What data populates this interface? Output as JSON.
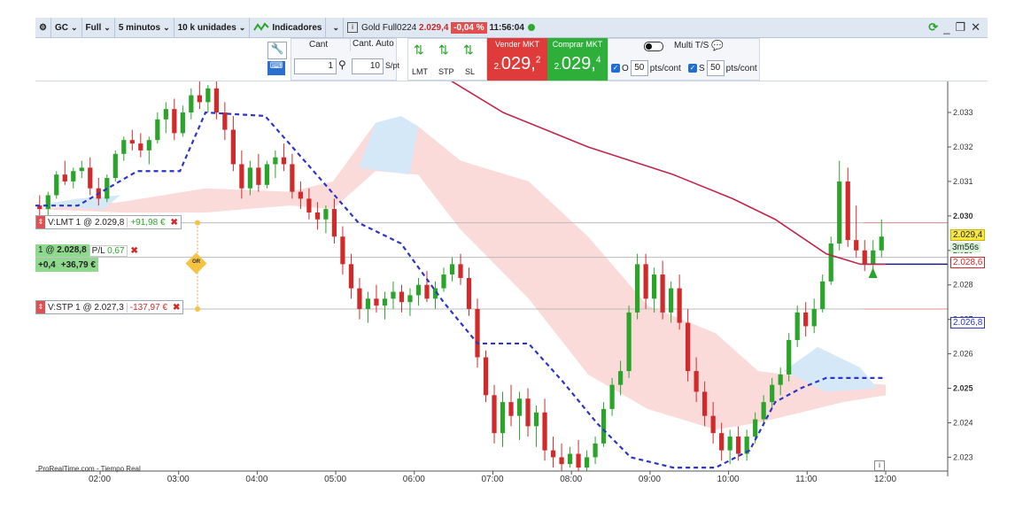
{
  "toolbar": {
    "symbol": "GC",
    "mode": "Full",
    "timeframe": "5 minutos",
    "units": "10 k unidades",
    "indicators": "Indicadores",
    "instrument": "Gold Full0224",
    "last_price": "2.029,4",
    "change_pct": "-0,04 %",
    "clock": "11:56:04"
  },
  "order_panel": {
    "cant_label": "Cant",
    "cant_auto_label": "Cant. Auto",
    "cant_value": "1",
    "spt_value": "10",
    "spt_label": "S/pt",
    "lmt_label": "LMT",
    "stp_label": "STP",
    "sl_label": "SL",
    "sell_label": "Vender MKT",
    "sell_price_prefix": "2.",
    "sell_price_main": "029,",
    "sell_price_sup": "2",
    "buy_label": "Comprar MKT",
    "buy_price_prefix": "2.",
    "buy_price_main": "029,",
    "buy_price_sup": "4",
    "multi_label": "Multi T/S",
    "o_label": "O",
    "o_value": "50",
    "s_label": "S",
    "s_value": "50",
    "pts_label": "pts/cont"
  },
  "orders": {
    "lmt_text": "V:LMT  1  @  2.029,8",
    "lmt_pl": "+91,98 €",
    "pos_text_pre": "1  @ ",
    "pos_text_price": "2.028,8",
    "pos_pl_label": " P/L ",
    "pos_pl_value": "0,67",
    "pos_pts": "+0,4",
    "pos_eur": "+36,79 €",
    "oco_label": "OR",
    "stp_text": "V:STP  1  @  2.027,3",
    "stp_pl": "-137,97 €"
  },
  "price_tags": {
    "last": "2.029,4",
    "timer": "3m56s",
    "entry": "2.028,6",
    "baseline": "2.026,8"
  },
  "source_label": "ProRealTime.com - Tiempo Real",
  "chart_data": {
    "type": "candlestick",
    "x_ticks": [
      "02:00",
      "03:00",
      "04:00",
      "05:00",
      "06:00",
      "07:00",
      "08:00",
      "09:00",
      "10:00",
      "11:00",
      "12:00"
    ],
    "y_ticks": [
      "2.033",
      "2.032",
      "2.031",
      "2.030",
      "2.029",
      "2.028",
      "2.027",
      "2.026",
      "2.025",
      "2.024",
      "2.023"
    ],
    "y_range": [
      2022.6,
      2033.9
    ],
    "colors": {
      "up": "#2aa52a",
      "down": "#d22a2a",
      "ma": "#c0254a",
      "kijun": "#2d35c8",
      "cloud_red": "#fbdada",
      "cloud_blue": "#d4e8f8"
    },
    "candles": [
      [
        2030.3,
        2030.6,
        2029.9,
        2030.2
      ],
      [
        2030.2,
        2030.7,
        2030.0,
        2030.6
      ],
      [
        2030.6,
        2031.3,
        2030.5,
        2031.2
      ],
      [
        2031.2,
        2031.6,
        2030.9,
        2031.0
      ],
      [
        2031.0,
        2031.4,
        2030.8,
        2031.3
      ],
      [
        2031.3,
        2031.6,
        2031.1,
        2031.4
      ],
      [
        2031.4,
        2031.7,
        2030.6,
        2030.8
      ],
      [
        2030.8,
        2031.1,
        2030.3,
        2030.5
      ],
      [
        2030.5,
        2031.2,
        2030.4,
        2031.1
      ],
      [
        2031.1,
        2031.9,
        2031.0,
        2031.8
      ],
      [
        2031.8,
        2032.3,
        2031.6,
        2032.2
      ],
      [
        2032.2,
        2032.5,
        2031.9,
        2032.1
      ],
      [
        2032.1,
        2032.4,
        2031.7,
        2031.9
      ],
      [
        2031.9,
        2032.3,
        2031.5,
        2032.2
      ],
      [
        2032.2,
        2033.0,
        2032.1,
        2032.8
      ],
      [
        2032.8,
        2033.3,
        2032.4,
        2033.1
      ],
      [
        2033.1,
        2033.4,
        2032.2,
        2032.4
      ],
      [
        2032.4,
        2033.2,
        2032.3,
        2033.0
      ],
      [
        2033.0,
        2033.7,
        2032.8,
        2033.5
      ],
      [
        2033.5,
        2033.9,
        2033.1,
        2033.3
      ],
      [
        2033.3,
        2033.8,
        2033.0,
        2033.7
      ],
      [
        2033.7,
        2033.9,
        2032.8,
        2033.0
      ],
      [
        2033.0,
        2033.3,
        2032.2,
        2032.5
      ],
      [
        2032.5,
        2032.9,
        2031.3,
        2031.5
      ],
      [
        2031.5,
        2031.9,
        2030.5,
        2030.8
      ],
      [
        2030.8,
        2031.6,
        2030.6,
        2031.4
      ],
      [
        2031.4,
        2031.8,
        2030.7,
        2030.9
      ],
      [
        2030.9,
        2031.6,
        2030.8,
        2031.5
      ],
      [
        2031.5,
        2031.9,
        2031.1,
        2031.7
      ],
      [
        2031.7,
        2032.1,
        2031.3,
        2031.5
      ],
      [
        2031.5,
        2031.8,
        2030.5,
        2030.7
      ],
      [
        2030.7,
        2031.0,
        2030.2,
        2030.5
      ],
      [
        2030.5,
        2030.8,
        2029.9,
        2030.1
      ],
      [
        2030.1,
        2030.4,
        2029.6,
        2029.9
      ],
      [
        2029.9,
        2030.3,
        2029.5,
        2030.2
      ],
      [
        2030.2,
        2030.5,
        2029.2,
        2029.4
      ],
      [
        2029.4,
        2029.7,
        2028.3,
        2028.6
      ],
      [
        2028.6,
        2028.9,
        2027.6,
        2027.9
      ],
      [
        2027.9,
        2028.2,
        2027.0,
        2027.3
      ],
      [
        2027.3,
        2027.8,
        2026.9,
        2027.6
      ],
      [
        2027.6,
        2028.0,
        2027.2,
        2027.4
      ],
      [
        2027.4,
        2027.8,
        2027.0,
        2027.6
      ],
      [
        2027.6,
        2028.1,
        2027.3,
        2027.8
      ],
      [
        2027.8,
        2028.0,
        2027.2,
        2027.5
      ],
      [
        2027.5,
        2027.9,
        2027.1,
        2027.7
      ],
      [
        2027.7,
        2028.2,
        2027.4,
        2028.0
      ],
      [
        2028.0,
        2028.4,
        2027.5,
        2027.6
      ],
      [
        2027.6,
        2028.1,
        2027.3,
        2027.9
      ],
      [
        2027.9,
        2028.5,
        2027.8,
        2028.3
      ],
      [
        2028.3,
        2028.8,
        2028.1,
        2028.6
      ],
      [
        2028.6,
        2028.9,
        2028.0,
        2028.2
      ],
      [
        2028.2,
        2028.5,
        2027.1,
        2027.3
      ],
      [
        2027.3,
        2027.6,
        2025.6,
        2025.9
      ],
      [
        2025.9,
        2026.1,
        2024.6,
        2024.8
      ],
      [
        2024.8,
        2025.1,
        2023.4,
        2023.7
      ],
      [
        2023.7,
        2024.9,
        2023.3,
        2024.6
      ],
      [
        2024.6,
        2025.1,
        2023.9,
        2024.2
      ],
      [
        2024.2,
        2024.9,
        2023.5,
        2024.7
      ],
      [
        2024.7,
        2025.0,
        2023.6,
        2023.9
      ],
      [
        2023.9,
        2024.5,
        2023.3,
        2024.3
      ],
      [
        2024.3,
        2024.7,
        2022.9,
        2023.2
      ],
      [
        2023.2,
        2023.6,
        2022.7,
        2023.0
      ],
      [
        2023.0,
        2023.4,
        2022.6,
        2022.8
      ],
      [
        2022.8,
        2023.3,
        2022.7,
        2023.1
      ],
      [
        2023.1,
        2023.5,
        2022.6,
        2022.7
      ],
      [
        2022.7,
        2023.2,
        2022.6,
        2023.0
      ],
      [
        2023.0,
        2023.6,
        2022.8,
        2023.4
      ],
      [
        2023.4,
        2024.6,
        2023.3,
        2024.4
      ],
      [
        2024.4,
        2025.3,
        2024.2,
        2025.1
      ],
      [
        2025.1,
        2025.8,
        2024.8,
        2025.5
      ],
      [
        2025.5,
        2027.4,
        2025.3,
        2027.2
      ],
      [
        2027.2,
        2028.9,
        2027.0,
        2028.6
      ],
      [
        2028.6,
        2028.9,
        2027.3,
        2027.6
      ],
      [
        2027.6,
        2028.5,
        2027.2,
        2028.3
      ],
      [
        2028.3,
        2028.7,
        2027.0,
        2027.2
      ],
      [
        2027.2,
        2028.1,
        2026.9,
        2027.9
      ],
      [
        2027.9,
        2028.3,
        2026.7,
        2026.9
      ],
      [
        2026.9,
        2027.3,
        2025.2,
        2025.5
      ],
      [
        2025.5,
        2025.9,
        2024.6,
        2024.9
      ],
      [
        2024.9,
        2025.2,
        2023.9,
        2024.2
      ],
      [
        2024.2,
        2024.6,
        2023.4,
        2023.7
      ],
      [
        2023.7,
        2024.0,
        2022.9,
        2023.2
      ],
      [
        2023.2,
        2023.8,
        2022.8,
        2023.6
      ],
      [
        2023.6,
        2023.9,
        2022.9,
        2023.1
      ],
      [
        2023.1,
        2023.8,
        2022.9,
        2023.6
      ],
      [
        2023.6,
        2024.3,
        2023.4,
        2024.1
      ],
      [
        2024.1,
        2024.8,
        2023.9,
        2024.6
      ],
      [
        2024.6,
        2025.3,
        2024.4,
        2025.1
      ],
      [
        2025.1,
        2025.6,
        2024.8,
        2025.4
      ],
      [
        2025.4,
        2026.6,
        2025.2,
        2026.4
      ],
      [
        2026.4,
        2027.4,
        2026.2,
        2027.2
      ],
      [
        2027.2,
        2027.5,
        2026.5,
        2026.8
      ],
      [
        2026.8,
        2027.6,
        2026.6,
        2027.3
      ],
      [
        2027.3,
        2028.3,
        2027.2,
        2028.1
      ],
      [
        2028.1,
        2029.4,
        2028.0,
        2029.2
      ],
      [
        2029.2,
        2031.6,
        2029.0,
        2031.0
      ],
      [
        2031.0,
        2031.4,
        2029.1,
        2029.3
      ],
      [
        2029.3,
        2030.3,
        2028.8,
        2029.0
      ],
      [
        2029.0,
        2029.3,
        2028.4,
        2028.6
      ],
      [
        2028.6,
        2029.3,
        2028.3,
        2029.0
      ],
      [
        2029.0,
        2029.9,
        2028.8,
        2029.4
      ]
    ],
    "ma": [
      [
        0.43,
        2034.8
      ],
      [
        0.55,
        2033.0
      ],
      [
        0.65,
        2032.0
      ],
      [
        0.75,
        2031.2
      ],
      [
        0.82,
        2030.5
      ],
      [
        0.87,
        2029.9
      ],
      [
        0.9,
        2029.4
      ],
      [
        0.93,
        2028.9
      ],
      [
        0.97,
        2028.6
      ],
      [
        1.0,
        2028.6
      ]
    ],
    "kijun": [
      [
        0.0,
        2030.3
      ],
      [
        0.05,
        2030.3
      ],
      [
        0.12,
        2031.3
      ],
      [
        0.17,
        2031.3
      ],
      [
        0.2,
        2033.0
      ],
      [
        0.27,
        2032.9
      ],
      [
        0.32,
        2031.5
      ],
      [
        0.38,
        2029.8
      ],
      [
        0.43,
        2029.2
      ],
      [
        0.48,
        2027.5
      ],
      [
        0.52,
        2026.3
      ],
      [
        0.58,
        2026.3
      ],
      [
        0.62,
        2025.2
      ],
      [
        0.66,
        2024.0
      ],
      [
        0.7,
        2023.0
      ],
      [
        0.75,
        2022.7
      ],
      [
        0.8,
        2022.7
      ],
      [
        0.84,
        2023.2
      ],
      [
        0.87,
        2024.6
      ],
      [
        0.9,
        2025.0
      ],
      [
        0.93,
        2025.3
      ],
      [
        0.96,
        2025.3
      ],
      [
        1.0,
        2025.3
      ]
    ],
    "cloud_top": [
      [
        0.0,
        2030.2
      ],
      [
        0.1,
        2030.4
      ],
      [
        0.2,
        2030.8
      ],
      [
        0.3,
        2030.7
      ],
      [
        0.35,
        2031.0
      ],
      [
        0.4,
        2032.7
      ],
      [
        0.45,
        2032.6
      ],
      [
        0.5,
        2031.6
      ],
      [
        0.58,
        2031.0
      ],
      [
        0.65,
        2029.4
      ],
      [
        0.72,
        2027.4
      ],
      [
        0.8,
        2026.6
      ],
      [
        0.85,
        2025.5
      ],
      [
        0.95,
        2025.2
      ],
      [
        1.0,
        2025.1
      ]
    ],
    "cloud_bottom": [
      [
        0.0,
        2030.2
      ],
      [
        0.1,
        2030.1
      ],
      [
        0.2,
        2030.1
      ],
      [
        0.3,
        2030.3
      ],
      [
        0.35,
        2030.2
      ],
      [
        0.4,
        2031.3
      ],
      [
        0.45,
        2031.2
      ],
      [
        0.5,
        2029.6
      ],
      [
        0.58,
        2027.6
      ],
      [
        0.65,
        2025.4
      ],
      [
        0.72,
        2024.4
      ],
      [
        0.8,
        2023.8
      ],
      [
        0.85,
        2024.0
      ],
      [
        0.95,
        2024.6
      ],
      [
        1.0,
        2024.8
      ]
    ],
    "ref_lines": {
      "lmt": 2029.8,
      "position": 2028.8,
      "stp": 2027.3,
      "bid_ask": 2028.6,
      "baseline": 2026.8
    }
  }
}
